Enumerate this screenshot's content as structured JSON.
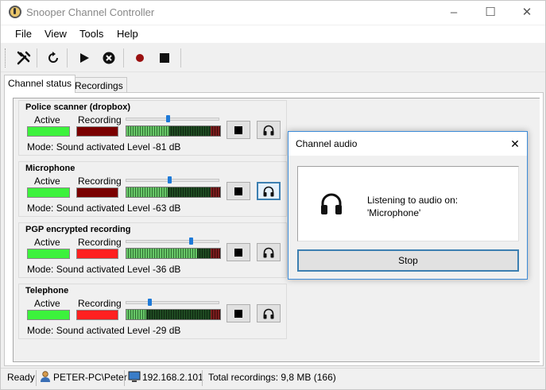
{
  "window": {
    "title": "Snooper Channel Controller"
  },
  "menu": [
    "File",
    "View",
    "Tools",
    "Help"
  ],
  "toolbar": [
    {
      "name": "settings-tool-icon"
    },
    {
      "name": "refresh-icon"
    },
    {
      "name": "play-icon"
    },
    {
      "name": "stop-circle-icon"
    },
    {
      "name": "record-icon"
    },
    {
      "name": "stop-square-icon"
    }
  ],
  "tabs": [
    "Channel status",
    "Recordings"
  ],
  "labels": {
    "active": "Active",
    "recording": "Recording",
    "mode_prefix": "Mode: ",
    "level_prefix": "Level  "
  },
  "channels": [
    {
      "name": "Police scanner (dropbox)",
      "mode": "Sound activated",
      "level": "-81 dB",
      "recording_on": false,
      "slider": 0.45,
      "meter": 0.5
    },
    {
      "name": "Microphone",
      "mode": "Sound activated",
      "level": "-63 dB",
      "recording_on": false,
      "slider": 0.47,
      "meter": 0.48
    },
    {
      "name": "PGP encrypted recording",
      "mode": "Sound activated",
      "level": "-36 dB",
      "recording_on": true,
      "slider": 0.71,
      "meter": 0.82
    },
    {
      "name": "Telephone",
      "mode": "Sound activated",
      "level": "-29 dB",
      "recording_on": true,
      "slider": 0.25,
      "meter": 0.23
    }
  ],
  "status": {
    "ready": "Ready",
    "user": "PETER-PC\\Peter",
    "ip": "192.168.2.101",
    "total": "Total recordings: 9,8 MB (166)"
  },
  "dialog": {
    "title": "Channel audio",
    "line1": "Listening to audio on:",
    "line2": "'Microphone'",
    "stop": "Stop"
  },
  "colors": {
    "active": "#3cf23c",
    "rec_off": "#7a0000",
    "rec_on": "#ff2020",
    "accent": "#3c7fb1"
  }
}
